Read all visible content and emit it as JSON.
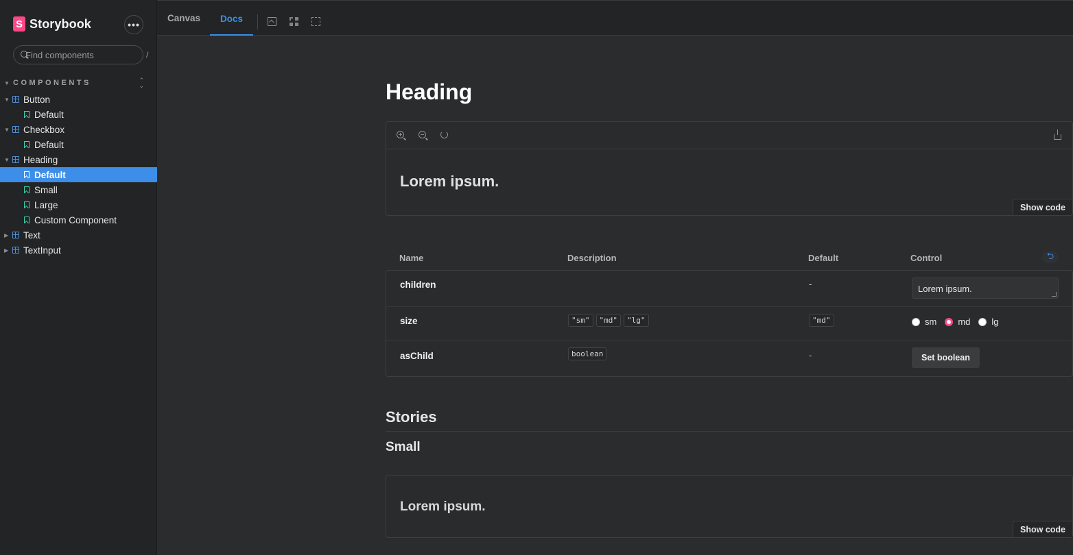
{
  "sidebar": {
    "brand": "Storybook",
    "brand_letter": "S",
    "menu_label": "•••",
    "search_placeholder": "Find components",
    "search_shortcut": "/",
    "section_label": "COMPONENTS",
    "tree": [
      {
        "label": "Button",
        "type": "component",
        "expanded": true
      },
      {
        "label": "Default",
        "type": "story"
      },
      {
        "label": "Checkbox",
        "type": "component",
        "expanded": true
      },
      {
        "label": "Default",
        "type": "story"
      },
      {
        "label": "Heading",
        "type": "component",
        "expanded": true
      },
      {
        "label": "Default",
        "type": "story",
        "selected": true
      },
      {
        "label": "Small",
        "type": "story"
      },
      {
        "label": "Large",
        "type": "story"
      },
      {
        "label": "Custom Component",
        "type": "story"
      },
      {
        "label": "Text",
        "type": "component",
        "expanded": false
      },
      {
        "label": "TextInput",
        "type": "component",
        "expanded": false
      }
    ]
  },
  "toolbar": {
    "tabs": [
      {
        "label": "Canvas",
        "active": false
      },
      {
        "label": "Docs",
        "active": true
      }
    ],
    "icons": [
      "image-icon",
      "grid-icon",
      "outline-icon"
    ]
  },
  "docs": {
    "title": "Heading",
    "preview_text": "Lorem ipsum.",
    "show_code": "Show code",
    "preview_icons": [
      "zoom-in-icon",
      "zoom-out-icon",
      "reset-zoom-icon",
      "share-icon"
    ],
    "args_table": {
      "headers": {
        "name": "Name",
        "description": "Description",
        "default": "Default",
        "control": "Control"
      },
      "reset_icon": "undo-icon",
      "rows": {
        "children": {
          "name": "children",
          "default": "-",
          "control_value": "Lorem ipsum."
        },
        "size": {
          "name": "size",
          "options": [
            "\"sm\"",
            "\"md\"",
            "\"lg\""
          ],
          "default": "\"md\"",
          "radio": [
            "sm",
            "md",
            "lg"
          ],
          "selected": "md"
        },
        "asChild": {
          "name": "asChild",
          "type": "boolean",
          "default": "-",
          "control_label": "Set boolean"
        }
      }
    },
    "stories_heading": "Stories",
    "story_small_heading": "Small",
    "story_small_preview": "Lorem ipsum.",
    "story_small_show_code": "Show code"
  },
  "colors": {
    "accent": "#3c8ee8",
    "brand": "#ff4785",
    "story_icon": "#37d5a9",
    "component_icon": "#4f8ede",
    "background": "#2b2c2d",
    "sidebar_bg": "#222425"
  }
}
